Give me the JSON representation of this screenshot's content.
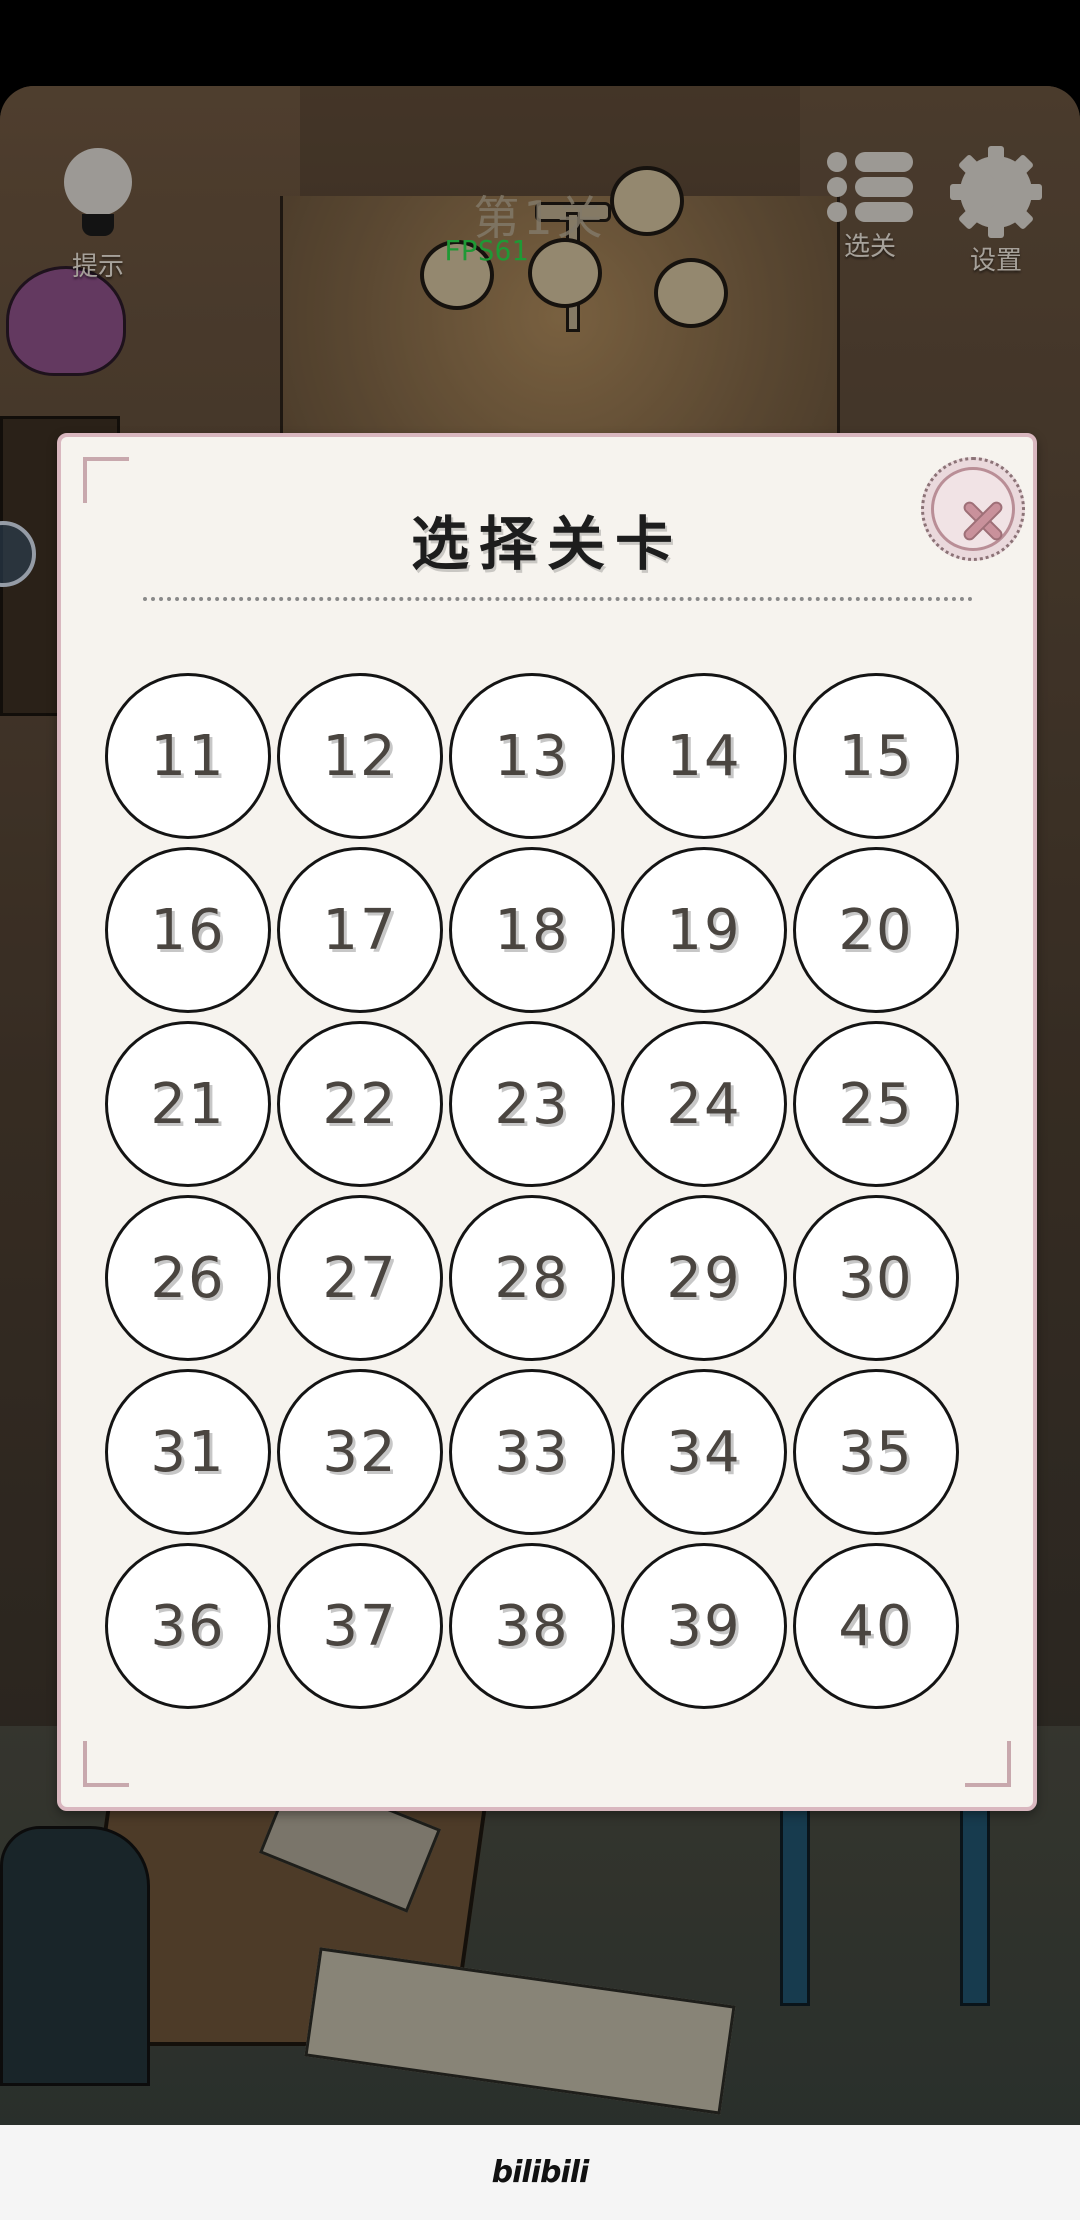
{
  "hud": {
    "hint_label": "提示",
    "level_title": "第1关",
    "fps": "FPS61",
    "select_label": "选关",
    "settings_label": "设置"
  },
  "modal": {
    "title": "选择关卡",
    "levels": [
      "11",
      "12",
      "13",
      "14",
      "15",
      "16",
      "17",
      "18",
      "19",
      "20",
      "21",
      "22",
      "23",
      "24",
      "25",
      "26",
      "27",
      "28",
      "29",
      "30",
      "31",
      "32",
      "33",
      "34",
      "35",
      "36",
      "37",
      "38",
      "39",
      "40"
    ]
  },
  "footer": {
    "brand": "bilibili"
  },
  "colors": {
    "modal_bg": "#f6f3ee",
    "modal_border": "#d9b7bf",
    "fps_green": "#2bd44a",
    "close_accent": "#c9919b"
  }
}
